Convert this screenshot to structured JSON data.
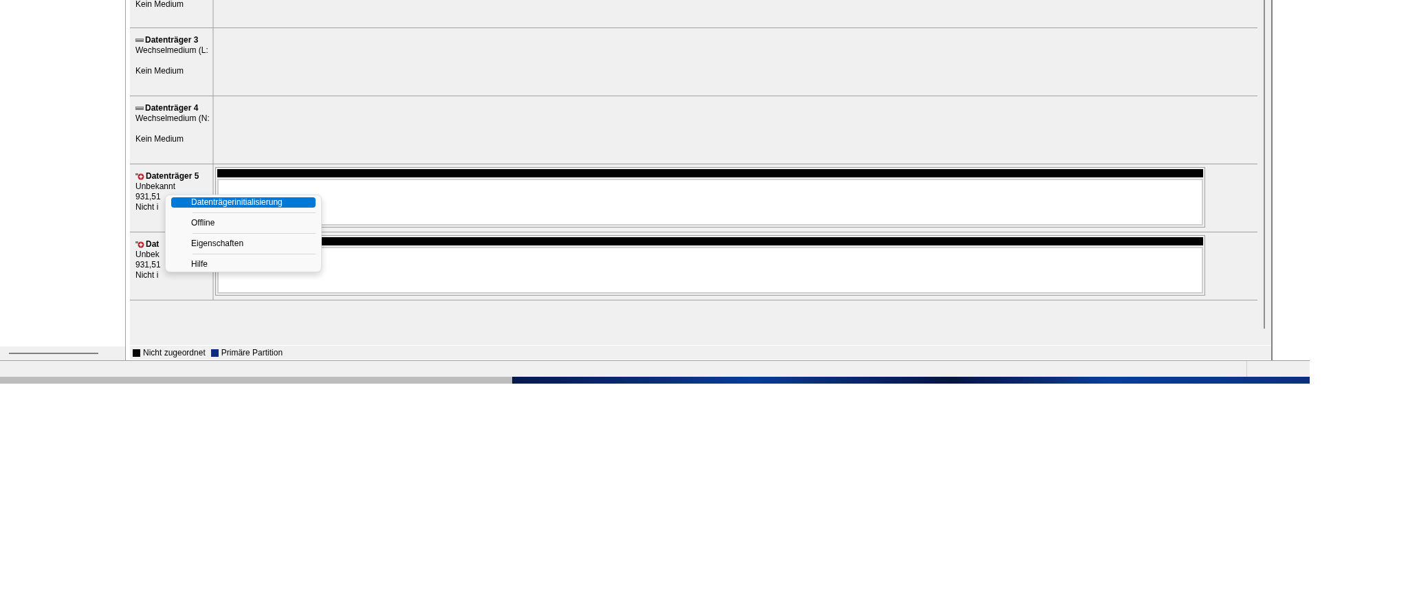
{
  "top_disk": {
    "lines": [
      "Kein Medium"
    ]
  },
  "disks": [
    {
      "name": "Datenträger 3",
      "kind": "removable",
      "lines": [
        "Wechselmedium (L:"
      ],
      "status": "Kein Medium"
    },
    {
      "name": "Datenträger 4",
      "kind": "removable",
      "lines": [
        "Wechselmedium (N:"
      ],
      "status": "Kein Medium"
    },
    {
      "name": "Datenträger 5",
      "kind": "not-initialized",
      "lines": [
        "Unbekannt",
        "931,51",
        "Nicht i"
      ],
      "partition": {
        "kind": "unallocated"
      }
    },
    {
      "name": "Dat",
      "kind": "not-initialized",
      "lines": [
        "Unbek",
        "931,51",
        "Nicht i"
      ],
      "partition": {
        "kind": "unallocated"
      }
    }
  ],
  "context_menu": [
    {
      "label": "Datenträgerinitialisierung",
      "selected": true
    },
    {
      "label": "Offline",
      "selected": false
    },
    {
      "label": "Eigenschaften",
      "selected": false
    },
    {
      "label": "Hilfe",
      "selected": false
    }
  ],
  "legend": [
    {
      "label": "Nicht zugeordnet",
      "color": "#000000"
    },
    {
      "label": "Primäre Partition",
      "color": "#0a2a86"
    }
  ]
}
